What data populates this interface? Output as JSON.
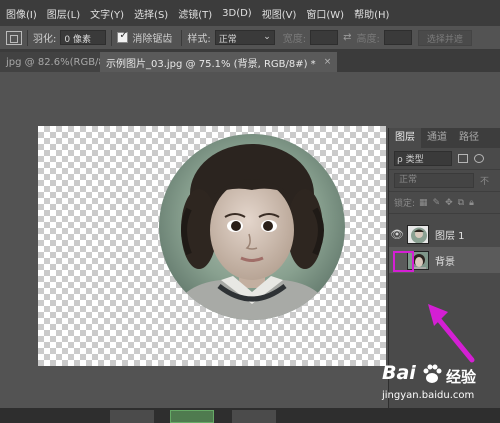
{
  "menu": {
    "items": [
      "图像(I)",
      "图层(L)",
      "文字(Y)",
      "选择(S)",
      "滤镜(T)",
      "3D(D)",
      "视图(V)",
      "窗口(W)",
      "帮助(H)"
    ]
  },
  "options": {
    "feather_label": "羽化:",
    "feather_value": "0 像素",
    "antialias_label": "消除锯齿",
    "antialias_checked": true,
    "style_label": "样式:",
    "style_value": "正常",
    "width_label": "宽度:",
    "height_label": "高度:",
    "select_mask_label": "选择并遮"
  },
  "tabs": [
    {
      "label": "jpg @ 82.6%(RGB/8#)",
      "close": "×",
      "active": false
    },
    {
      "label": "示例图片_03.jpg @ 75.1% (背景, RGB/8#) *",
      "close": "×",
      "active": true
    }
  ],
  "layers_panel": {
    "tabs": [
      "图层",
      "通道",
      "路径"
    ],
    "filter_label": "ρ 类型",
    "blend_mode": "正常",
    "opacity_hint": "不",
    "lock_label": "锁定:",
    "layers": [
      {
        "name": "图层 1",
        "visible": true,
        "selected": false
      },
      {
        "name": "背景",
        "visible": false,
        "selected": true
      }
    ]
  },
  "watermark": {
    "logo": "Bai",
    "brand": "经验",
    "url": "jingyan.baidu.com"
  },
  "colors": {
    "highlight": "#d41fd4",
    "arrow": "#d41fd4",
    "workspace": "#535353"
  },
  "icons": [
    "new-selection-icon",
    "eye-icon",
    "lock-pixels-icon",
    "lock-position-icon",
    "lock-artboard-icon",
    "lock-all-icon",
    "swap-icon",
    "dropdown-icon"
  ]
}
